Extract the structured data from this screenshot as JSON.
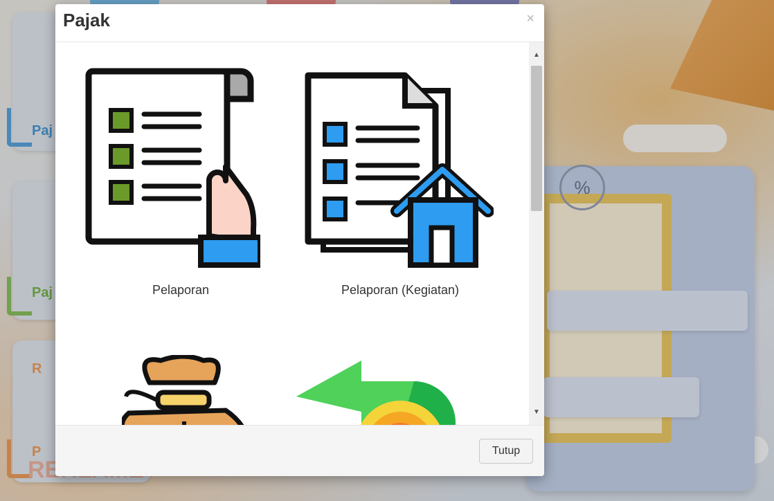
{
  "background": {
    "tile_labels": [
      "Paj",
      "Paj",
      "R",
      "P"
    ],
    "bottom_text": "REKLAME",
    "percent_glyph": "%"
  },
  "modal": {
    "title": "Pajak",
    "close_glyph": "×",
    "items": [
      {
        "label": "Pelaporan",
        "icon": "report-checklist-hand-icon"
      },
      {
        "label": "Pelaporan (Kegiatan)",
        "icon": "report-house-icon"
      },
      {
        "label": "",
        "icon": "money-bag-icon"
      },
      {
        "label": "",
        "icon": "return-arrow-coin-icon"
      }
    ],
    "footer": {
      "close_button": "Tutup"
    },
    "scroll": {
      "up": "▲",
      "down": "▼"
    }
  },
  "colors": {
    "accent_blue": "#2e9cf0",
    "accent_green": "#6a9a2a",
    "arrow_green": "#4fd15a",
    "coin_orange": "#f5a623"
  }
}
